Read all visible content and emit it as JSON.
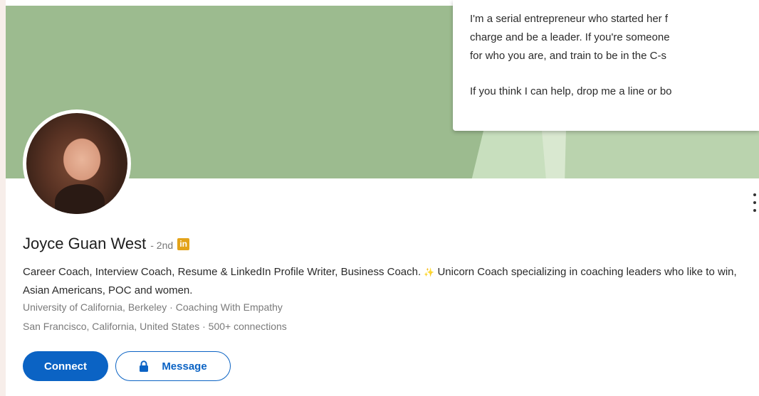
{
  "about": {
    "lines": [
      "I'm a serial entrepreneur who started her f",
      "charge and be a leader. If you're someone",
      "for who you are, and train to be in the C-s",
      "If you think I can help, drop me a line or bo"
    ]
  },
  "profile": {
    "name": "Joyce Guan West",
    "degree": "- 2nd",
    "badge": "in",
    "headline_part1": "Career Coach, Interview Coach, Resume & LinkedIn Profile Writer, Business Coach.",
    "headline_part2": "Unicorn Coach specializing in coaching leaders who like to win, Asian Americans, POC and women.",
    "education_company": "University of California, Berkeley · Coaching With Empathy",
    "location_connections": "San Francisco, California, United States · 500+ connections"
  },
  "actions": {
    "connect_label": "Connect",
    "message_label": "Message"
  },
  "icons": {
    "avatar": "profile-photo",
    "more": "more-vertical-icon",
    "lock": "lock-icon",
    "unicorn": "unicorn-icon",
    "linkedin_badge": "linkedin-badge-icon"
  },
  "colors": {
    "banner": "#9cbb8f",
    "primary": "#0b63c4",
    "badge": "#e3a31a"
  }
}
